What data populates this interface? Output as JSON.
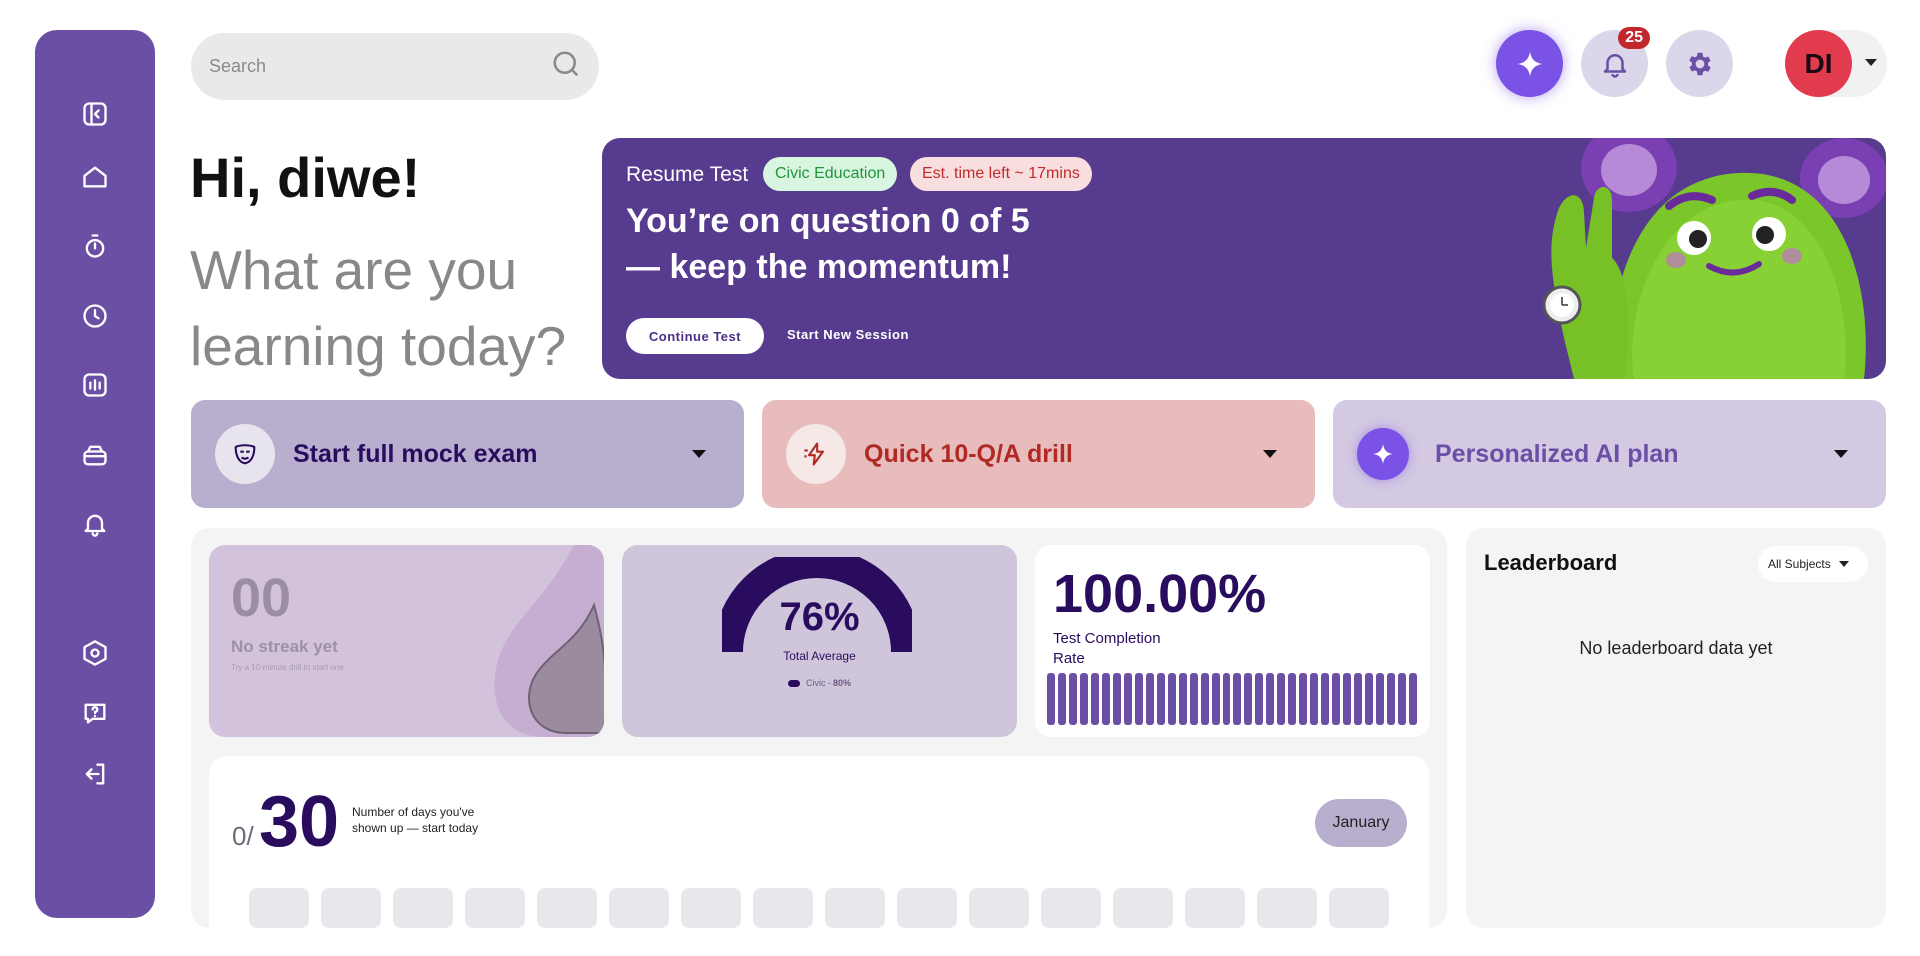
{
  "search": {
    "placeholder": "Search"
  },
  "header": {
    "notification_count": "25",
    "avatar_initials": "DI"
  },
  "greeting": {
    "title": "Hi, diwe!",
    "subtitle": "What are you learning today?"
  },
  "hero": {
    "resume_label": "Resume Test",
    "subject_tag": "Civic Education",
    "time_tag": "Est. time left ~ 17mins",
    "headline": "You’re on question 0 of 5 — keep the momentum!",
    "continue_label": "Continue Test",
    "new_session_label": "Start New Session"
  },
  "actions": [
    {
      "label": "Start full mock exam",
      "color": "#2a0c5e"
    },
    {
      "label": "Quick 10-Q/A drill",
      "color": "#b02a23"
    },
    {
      "label": "Personalized AI plan",
      "color": "#6b4fa5"
    }
  ],
  "streak": {
    "value": "00",
    "label": "No streak yet",
    "hint": "Try a 10-minute drill to start one"
  },
  "average": {
    "value": "76%",
    "label": "Total Average",
    "legend": "Civic - ",
    "legend_value": "80%"
  },
  "completion": {
    "value": "100.00%",
    "label": "Test Completion Rate",
    "level": 1.0
  },
  "calendar": {
    "shown": "0/",
    "total": "30",
    "note": "Number of days you've shown up — start today",
    "month": "January"
  },
  "leaderboard": {
    "title": "Leaderboard",
    "filter": "All Subjects",
    "empty": "No leaderboard data yet"
  },
  "colors": {
    "sidebar": "#6b4fa5",
    "hero": "#573b8f",
    "accent": "#2a0c5e",
    "ai": "#7b52e6"
  }
}
